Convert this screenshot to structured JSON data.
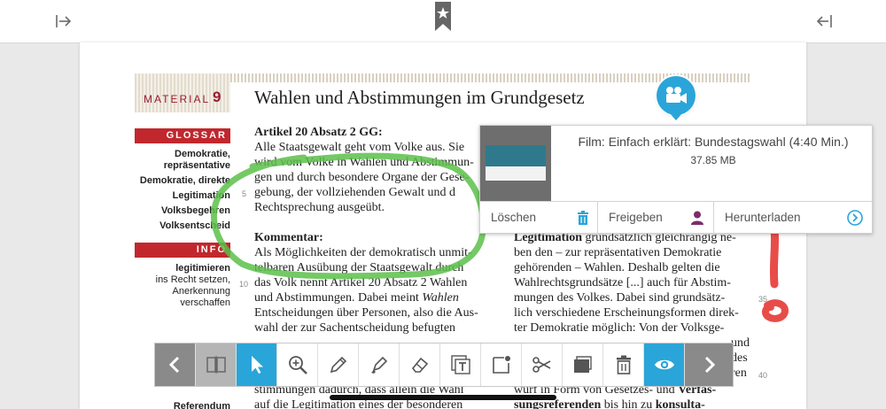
{
  "material": {
    "label": "MATERIAL",
    "number": "9",
    "title": "Wahlen und Abstimmungen im Grundgesetz"
  },
  "sidebar": {
    "glossar_heading": "GLOSSAR",
    "glossar_terms": [
      "Demokratie,",
      "repräsentative",
      "Demokratie, direkte",
      "Legitimation",
      "Volksbegehren",
      "Volksentscheid"
    ],
    "info_heading": "INFO",
    "info_term": "legitimieren",
    "info_lines": [
      "ins Recht setzen,",
      "Anerkennung",
      "verschaffen"
    ],
    "bottom_term": "Referendum"
  },
  "article": {
    "heading": "Artikel 20 Absatz 2 GG:",
    "lines": [
      "Alle Staatsgewalt geht vom Volke aus. Sie",
      "wird vom Volke in Wahlen und Abstimmun-",
      "gen und durch besondere Organe der Gese-",
      "gebung, der vollziehenden Gewalt und d",
      "Rechtsprechung ausgeübt."
    ]
  },
  "commentary": {
    "heading": "Kommentar:",
    "lines": [
      "Als Möglichkeiten der demokratisch unmit-",
      "telbaren Ausübung der Staatsgewalt durch",
      "das Volk nennt Artikel 20 Absatz 2 Wahlen",
      "und Abstimmungen. Dabei meint ",
      "Entscheidungen über Personen, also die Aus-",
      "wahl der zur Sachentscheidung befugten"
    ],
    "emphasis": "Wahlen",
    "bottom_lines": [
      "stimmungen dadurch, dass allein die Wahl",
      "auf die Legitimation eines der besonderen"
    ]
  },
  "right_column": {
    "first_bold": "Legitimation",
    "first_rest": " grundsätzlich gleichrangig ne-",
    "lines": [
      "ben den – zur repräsentativen Demokratie",
      "gehörenden – Wahlen. Deshalb gelten die",
      "Wahlrechtsgrundsätze [...] auch für Abstim-",
      "mungen des Volkes. Dabei sind grundsätz-",
      "lich verschiedene Erscheinungsformen direk-",
      "ter Demokratie möglich: Von der Volksge-"
    ],
    "partial_right": [
      "und",
      "des",
      "ren"
    ],
    "bottom_line_1": "wurf in Form von Gesetzes- und ",
    "bottom_bold_1": "Verfas-",
    "bottom_bold_2": "sungsreferenden",
    "bottom_line_2": " bis hin zu ",
    "bottom_bold_3": "konsulta-"
  },
  "line_numbers": [
    "5",
    "10",
    "35",
    "40"
  ],
  "popup": {
    "film_title": "Film: Einfach erklärt: Bundestagswahl (4:40 Min.)",
    "file_size": "37.85 MB",
    "actions": {
      "delete": "Löschen",
      "share": "Freigeben",
      "download": "Herunterladen"
    }
  },
  "colors": {
    "accent": "#2aa5d9",
    "brand_red": "#c1272d",
    "marker_green": "#5cbf4a",
    "marker_red": "#e53935"
  },
  "icons": {
    "toolbar": [
      "chevron-left-icon",
      "book-icon",
      "pointer-icon",
      "zoom-in-icon",
      "pencil-icon",
      "highlighter-icon",
      "eraser-icon",
      "text-box-icon",
      "note-icon",
      "scissors-icon",
      "screen-icon",
      "trash-icon",
      "eye-icon",
      "chevron-right-icon"
    ]
  }
}
